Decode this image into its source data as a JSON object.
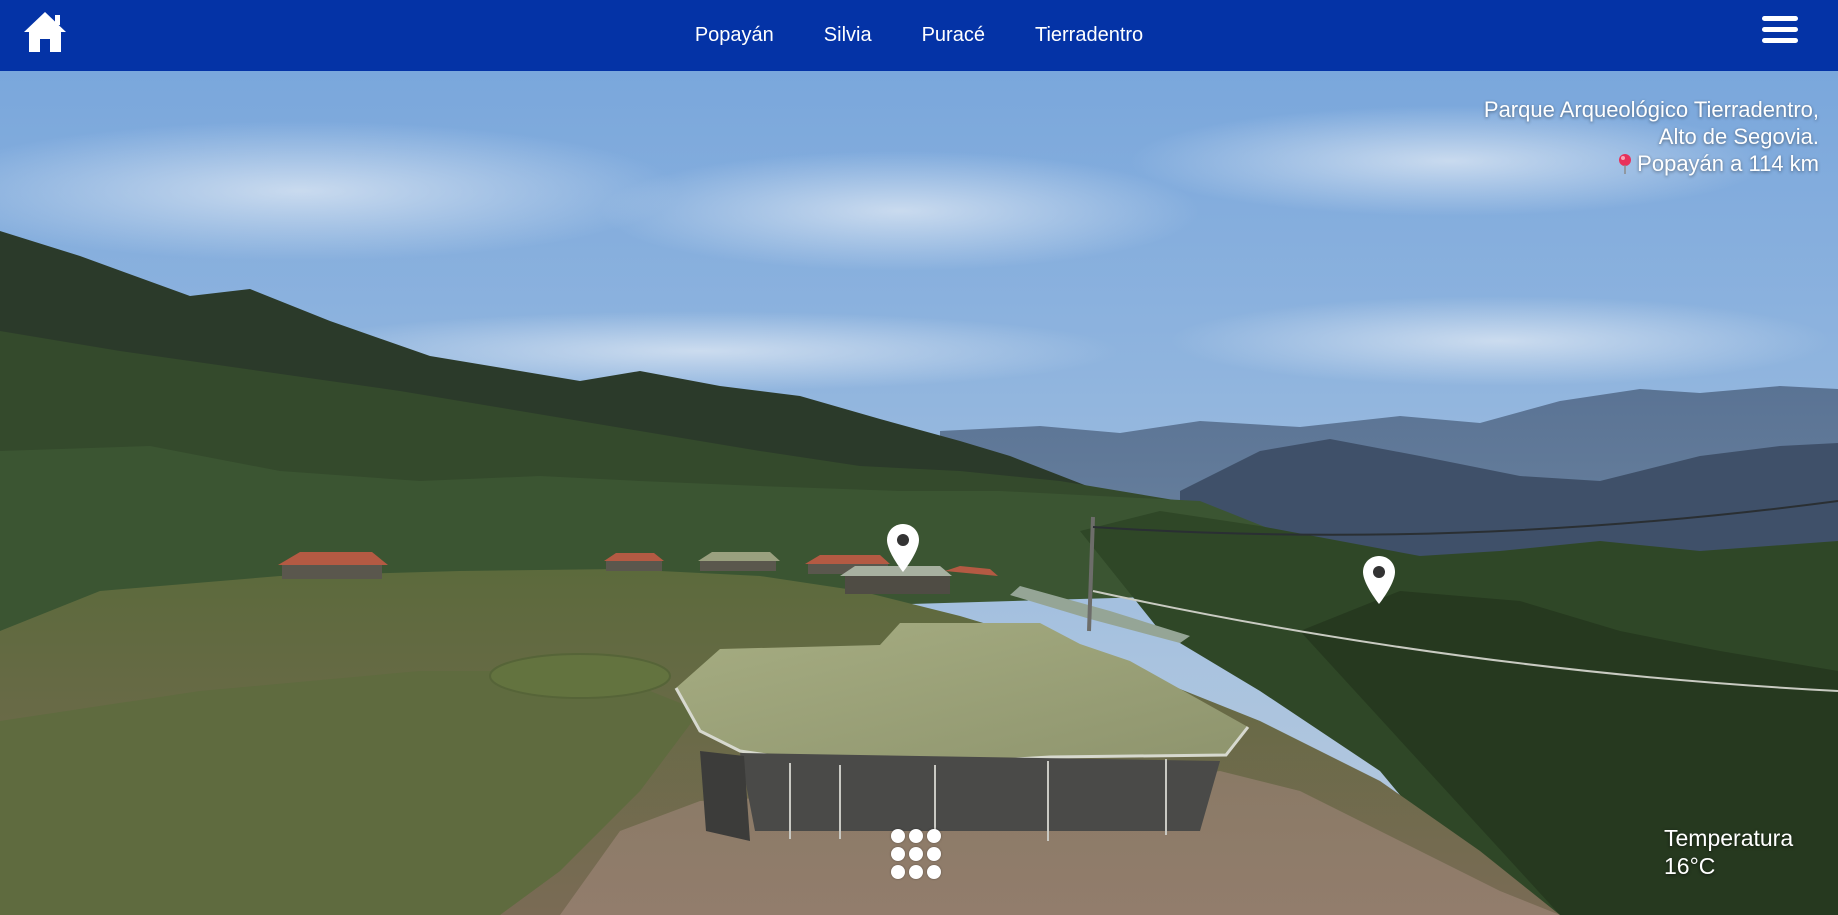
{
  "nav": {
    "home_icon": "home-icon",
    "links": [
      {
        "label": "Popayán"
      },
      {
        "label": "Silvia"
      },
      {
        "label": "Puracé"
      },
      {
        "label": "Tierradentro"
      }
    ],
    "menu_icon": "hamburger-menu-icon"
  },
  "location": {
    "line1": "Parque Arqueológico Tierradentro,",
    "line2": "Alto de Segovia.",
    "distance_icon": "map-pin-icon",
    "distance": "Popayán a 114 km"
  },
  "weather": {
    "label": "Temperatura",
    "value": "16°C"
  },
  "hotspots": [
    {
      "icon": "map-marker-icon"
    },
    {
      "icon": "map-marker-icon"
    }
  ],
  "controls": {
    "grid_icon": "grid-dots-icon"
  },
  "colors": {
    "topbar": "#0433a6",
    "text": "#ffffff",
    "pin_accent": "#e8315b"
  }
}
